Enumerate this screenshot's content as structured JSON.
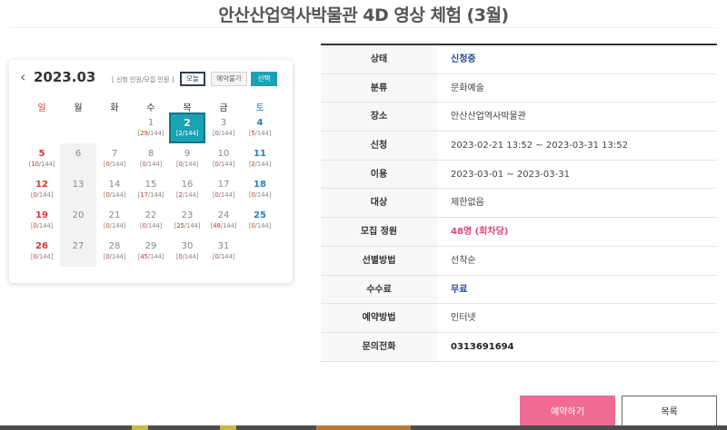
{
  "page": {
    "title": "안산산업역사박물관 4D 영상 체험 (3월)"
  },
  "calendar": {
    "prev_label": "‹",
    "next_label": "›",
    "month": "2023.03",
    "legend_note": "[ 신청 인원/모집 인원 ]",
    "btn_today": "오늘",
    "btn_unavailable": "예약불가",
    "btn_selected": "선택",
    "weekdays": [
      "일",
      "월",
      "화",
      "수",
      "목",
      "금",
      "토"
    ],
    "days": [
      {
        "day": "1",
        "applied": "29",
        "total": "144",
        "col": 3,
        "row": 0,
        "type": "weekday"
      },
      {
        "day": "2",
        "applied": "2",
        "total": "144",
        "col": 4,
        "row": 0,
        "type": "selected"
      },
      {
        "day": "3",
        "applied": "0",
        "total": "144",
        "col": 5,
        "row": 0,
        "type": "weekday"
      },
      {
        "day": "4",
        "applied": "5",
        "total": "144",
        "col": 6,
        "row": 0,
        "type": "sat"
      },
      {
        "day": "5",
        "applied": "10",
        "total": "144",
        "col": 0,
        "row": 1,
        "type": "sun"
      },
      {
        "day": "6",
        "applied": "",
        "total": "",
        "col": 1,
        "row": 1,
        "type": "noavail"
      },
      {
        "day": "7",
        "applied": "0",
        "total": "144",
        "col": 2,
        "row": 1,
        "type": "weekday"
      },
      {
        "day": "8",
        "applied": "0",
        "total": "144",
        "col": 3,
        "row": 1,
        "type": "weekday"
      },
      {
        "day": "9",
        "applied": "0",
        "total": "144",
        "col": 4,
        "row": 1,
        "type": "weekday"
      },
      {
        "day": "10",
        "applied": "0",
        "total": "144",
        "col": 5,
        "row": 1,
        "type": "weekday"
      },
      {
        "day": "11",
        "applied": "2",
        "total": "144",
        "col": 6,
        "row": 1,
        "type": "sat"
      },
      {
        "day": "12",
        "applied": "0",
        "total": "144",
        "col": 0,
        "row": 2,
        "type": "sun"
      },
      {
        "day": "13",
        "applied": "",
        "total": "",
        "col": 1,
        "row": 2,
        "type": "noavail"
      },
      {
        "day": "14",
        "applied": "0",
        "total": "144",
        "col": 2,
        "row": 2,
        "type": "weekday"
      },
      {
        "day": "15",
        "applied": "17",
        "total": "144",
        "col": 3,
        "row": 2,
        "type": "weekday"
      },
      {
        "day": "16",
        "applied": "2",
        "total": "144",
        "col": 4,
        "row": 2,
        "type": "weekday"
      },
      {
        "day": "17",
        "applied": "0",
        "total": "144",
        "col": 5,
        "row": 2,
        "type": "weekday"
      },
      {
        "day": "18",
        "applied": "0",
        "total": "144",
        "col": 6,
        "row": 2,
        "type": "sat"
      },
      {
        "day": "19",
        "applied": "0",
        "total": "144",
        "col": 0,
        "row": 3,
        "type": "sun"
      },
      {
        "day": "20",
        "applied": "",
        "total": "",
        "col": 1,
        "row": 3,
        "type": "noavail"
      },
      {
        "day": "21",
        "applied": "0",
        "total": "144",
        "col": 2,
        "row": 3,
        "type": "weekday"
      },
      {
        "day": "22",
        "applied": "0",
        "total": "144",
        "col": 3,
        "row": 3,
        "type": "weekday"
      },
      {
        "day": "23",
        "applied": "25",
        "total": "144",
        "col": 4,
        "row": 3,
        "type": "weekday"
      },
      {
        "day": "24",
        "applied": "48",
        "total": "144",
        "col": 5,
        "row": 3,
        "type": "weekday"
      },
      {
        "day": "25",
        "applied": "0",
        "total": "144",
        "col": 6,
        "row": 3,
        "type": "sat"
      },
      {
        "day": "26",
        "applied": "0",
        "total": "144",
        "col": 0,
        "row": 4,
        "type": "sun"
      },
      {
        "day": "27",
        "applied": "",
        "total": "",
        "col": 1,
        "row": 4,
        "type": "noavail"
      },
      {
        "day": "28",
        "applied": "0",
        "total": "144",
        "col": 2,
        "row": 4,
        "type": "weekday"
      },
      {
        "day": "29",
        "applied": "45",
        "total": "144",
        "col": 3,
        "row": 4,
        "type": "weekday"
      },
      {
        "day": "30",
        "applied": "0",
        "total": "144",
        "col": 4,
        "row": 4,
        "type": "weekday"
      },
      {
        "day": "31",
        "applied": "0",
        "total": "144",
        "col": 5,
        "row": 4,
        "type": "weekday"
      }
    ]
  },
  "info": [
    {
      "label": "상태",
      "value": "신청중",
      "style": "status"
    },
    {
      "label": "분류",
      "value": "문화예술",
      "style": ""
    },
    {
      "label": "장소",
      "value": "안산산업역사박물관",
      "style": ""
    },
    {
      "label": "신청",
      "value": "2023-02-21 13:52 ~ 2023-03-31 13:52",
      "style": ""
    },
    {
      "label": "이용",
      "value": "2023-03-01 ~ 2023-03-31",
      "style": ""
    },
    {
      "label": "대상",
      "value": "제한없음",
      "style": ""
    },
    {
      "label": "모집 정원",
      "value": "48명 (회차당)",
      "style": "pink"
    },
    {
      "label": "선별방법",
      "value": "선착순",
      "style": ""
    },
    {
      "label": "수수료",
      "value": "무료",
      "style": "fee"
    },
    {
      "label": "예약방법",
      "value": "인터넷",
      "style": ""
    },
    {
      "label": "문의전화",
      "value": "0313691694",
      "style": "phone"
    }
  ],
  "actions": {
    "reserve": "예약하기",
    "list": "목록"
  },
  "colors": {
    "accent": "#1aa2b4",
    "reserve": "#f06b93",
    "sunday": "#d33333",
    "saturday": "#2a7fc5",
    "status": "#2b4a8c"
  }
}
